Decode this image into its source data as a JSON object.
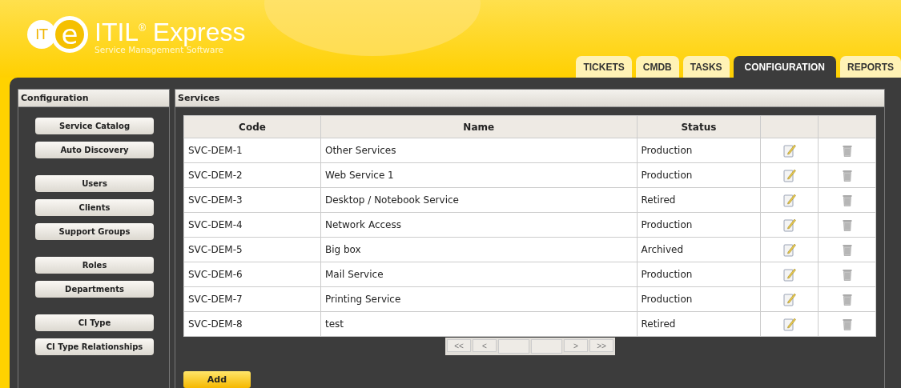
{
  "logo": {
    "badge": "IT",
    "letter": "e",
    "title": "ITIL",
    "mark": "®",
    "title_rest": "Express",
    "subtitle": "Service Management Software"
  },
  "tabs": [
    {
      "label": "TICKETS",
      "selected": false
    },
    {
      "label": "CMDB",
      "selected": false
    },
    {
      "label": "TASKS",
      "selected": false
    },
    {
      "label": "CONFIGURATION",
      "selected": true
    },
    {
      "label": "REPORTS",
      "selected": false
    }
  ],
  "sidebar": {
    "title": "Configuration",
    "groups": [
      [
        "Service Catalog",
        "Auto Discovery"
      ],
      [
        "Users",
        "Clients",
        "Support Groups"
      ],
      [
        "Roles",
        "Departments"
      ],
      [
        "CI Type",
        "CI Type Relationships"
      ]
    ]
  },
  "services": {
    "title": "Services",
    "columns": [
      "Code",
      "Name",
      "Status"
    ],
    "rows": [
      [
        "SVC-DEM-1",
        "Other Services",
        "Production"
      ],
      [
        "SVC-DEM-2",
        "Web Service 1",
        "Production"
      ],
      [
        "SVC-DEM-3",
        "Desktop / Notebook Service",
        "Retired"
      ],
      [
        "SVC-DEM-4",
        "Network Access",
        "Production"
      ],
      [
        "SVC-DEM-5",
        "Big box",
        "Archived"
      ],
      [
        "SVC-DEM-6",
        "Mail Service",
        "Production"
      ],
      [
        "SVC-DEM-7",
        "Printing Service",
        "Production"
      ],
      [
        "SVC-DEM-8",
        "test",
        "Retired"
      ]
    ],
    "pager": {
      "first": "<<",
      "prev": "<",
      "next": ">",
      "last": ">>"
    },
    "add_button": "Add"
  }
}
